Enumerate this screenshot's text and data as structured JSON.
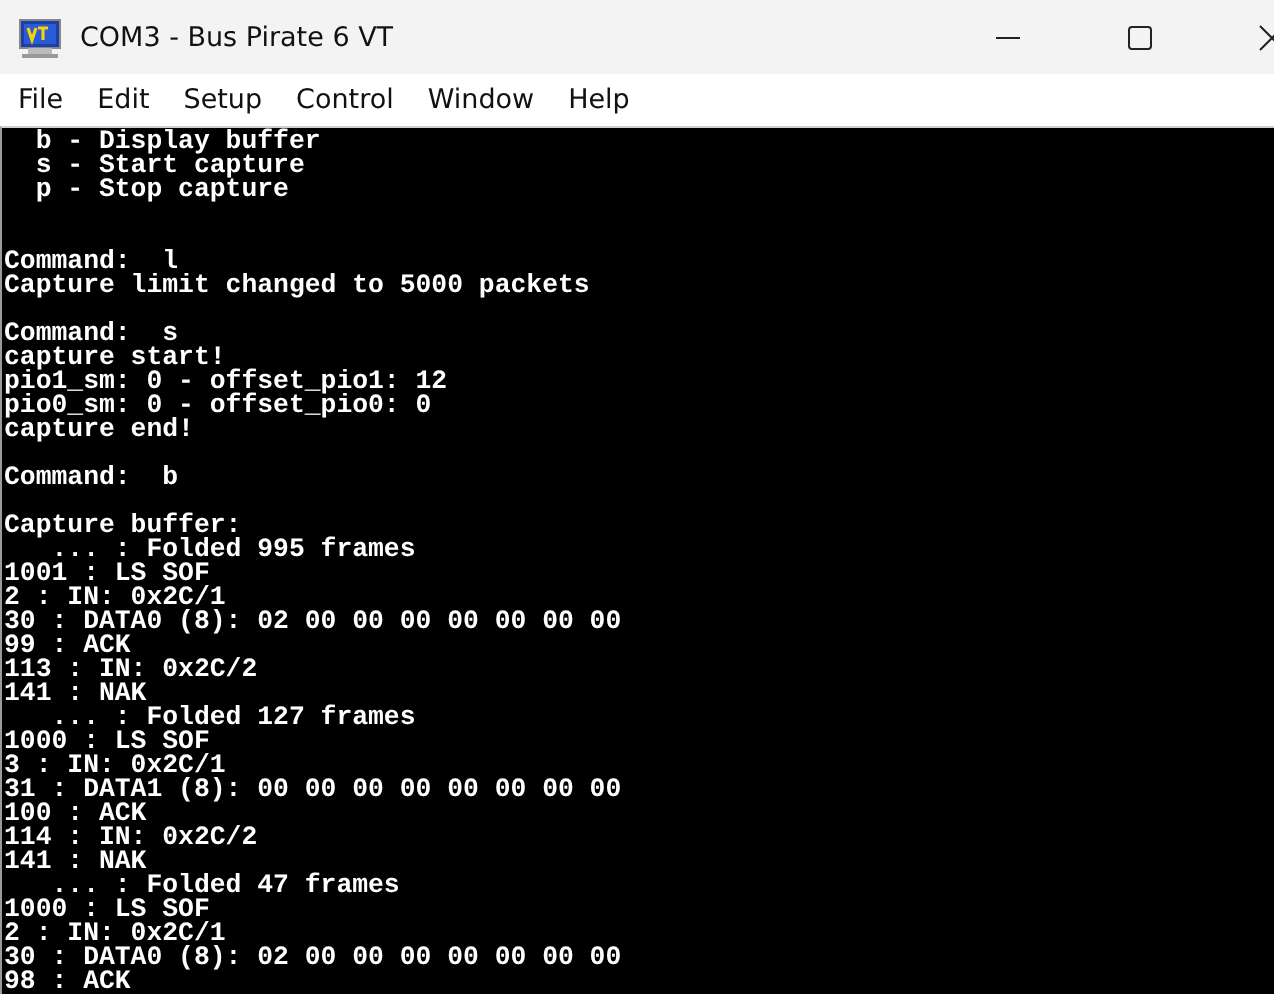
{
  "window": {
    "title": "COM3 - Bus Pirate 6 VT"
  },
  "menu": [
    "File",
    "Edit",
    "Setup",
    "Control",
    "Window",
    "Help"
  ],
  "terminal": {
    "blocks": [
      {
        "lines": [
          "  b - Display buffer",
          "  s - Start capture",
          "  p - Stop capture"
        ],
        "kind": "help"
      },
      {
        "lines": [
          "Command:  l",
          "Capture limit changed to 5000 packets"
        ],
        "kind": "output"
      },
      {
        "lines": [
          "Command:  s",
          "capture start!",
          "pio1_sm: 0 - offset_pio1: 12",
          "pio0_sm: 0 - offset_pio0: 0",
          "capture end!"
        ],
        "kind": "output"
      },
      {
        "lines": [
          "Command:  b"
        ],
        "kind": "output"
      },
      {
        "lines": [
          "Capture buffer:",
          "   ... : Folded 995 frames",
          "1001 : LS SOF",
          "2 : IN: 0x2C/1",
          "30 : DATA0 (8): 02 00 00 00 00 00 00 00",
          "99 : ACK",
          "113 : IN: 0x2C/2",
          "141 : NAK",
          "   ... : Folded 127 frames",
          "1000 : LS SOF",
          "3 : IN: 0x2C/1",
          "31 : DATA1 (8): 00 00 00 00 00 00 00 00",
          "100 : ACK",
          "114 : IN: 0x2C/2",
          "141 : NAK",
          "   ... : Folded 47 frames",
          "1000 : LS SOF",
          "2 : IN: 0x2C/1",
          "30 : DATA0 (8): 02 00 00 00 00 00 00 00",
          "98 : ACK"
        ],
        "kind": "output"
      }
    ]
  }
}
